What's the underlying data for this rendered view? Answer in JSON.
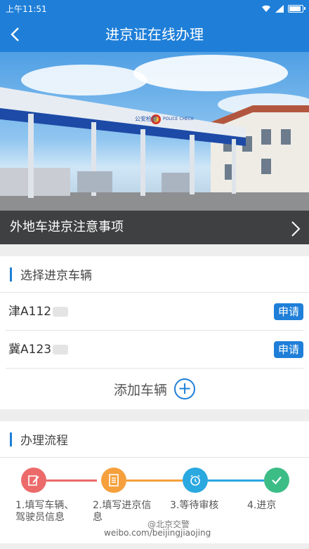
{
  "status": {
    "time": "上午11:51"
  },
  "nav": {
    "title": "进京证在线办理"
  },
  "banner": {
    "caption": "外地车进京注意事项",
    "sign_text": "公安检查",
    "sign_text_en": "POLICE CHECK"
  },
  "vehicles": {
    "section_title": "选择进京车辆",
    "items": [
      {
        "plate": "津A112",
        "apply_label": "申请"
      },
      {
        "plate": "冀A123",
        "apply_label": "申请"
      }
    ],
    "add_label": "添加车辆"
  },
  "process": {
    "section_title": "办理流程",
    "steps": [
      {
        "label": "1.填写车辆、驾驶员信息",
        "color": "#ec6a6a",
        "icon": "edit-icon"
      },
      {
        "label": "2.填写进京信息",
        "color": "#f5a03c",
        "icon": "document-icon"
      },
      {
        "label": "3.等待审核",
        "color": "#2aa8e0",
        "icon": "alarm-clock-icon"
      },
      {
        "label": "4.进京",
        "color": "#3dbd86",
        "icon": "check-icon"
      }
    ]
  },
  "watermark": {
    "text": "weibo.com/beijingjiaojing",
    "handle": "@北京交警"
  }
}
